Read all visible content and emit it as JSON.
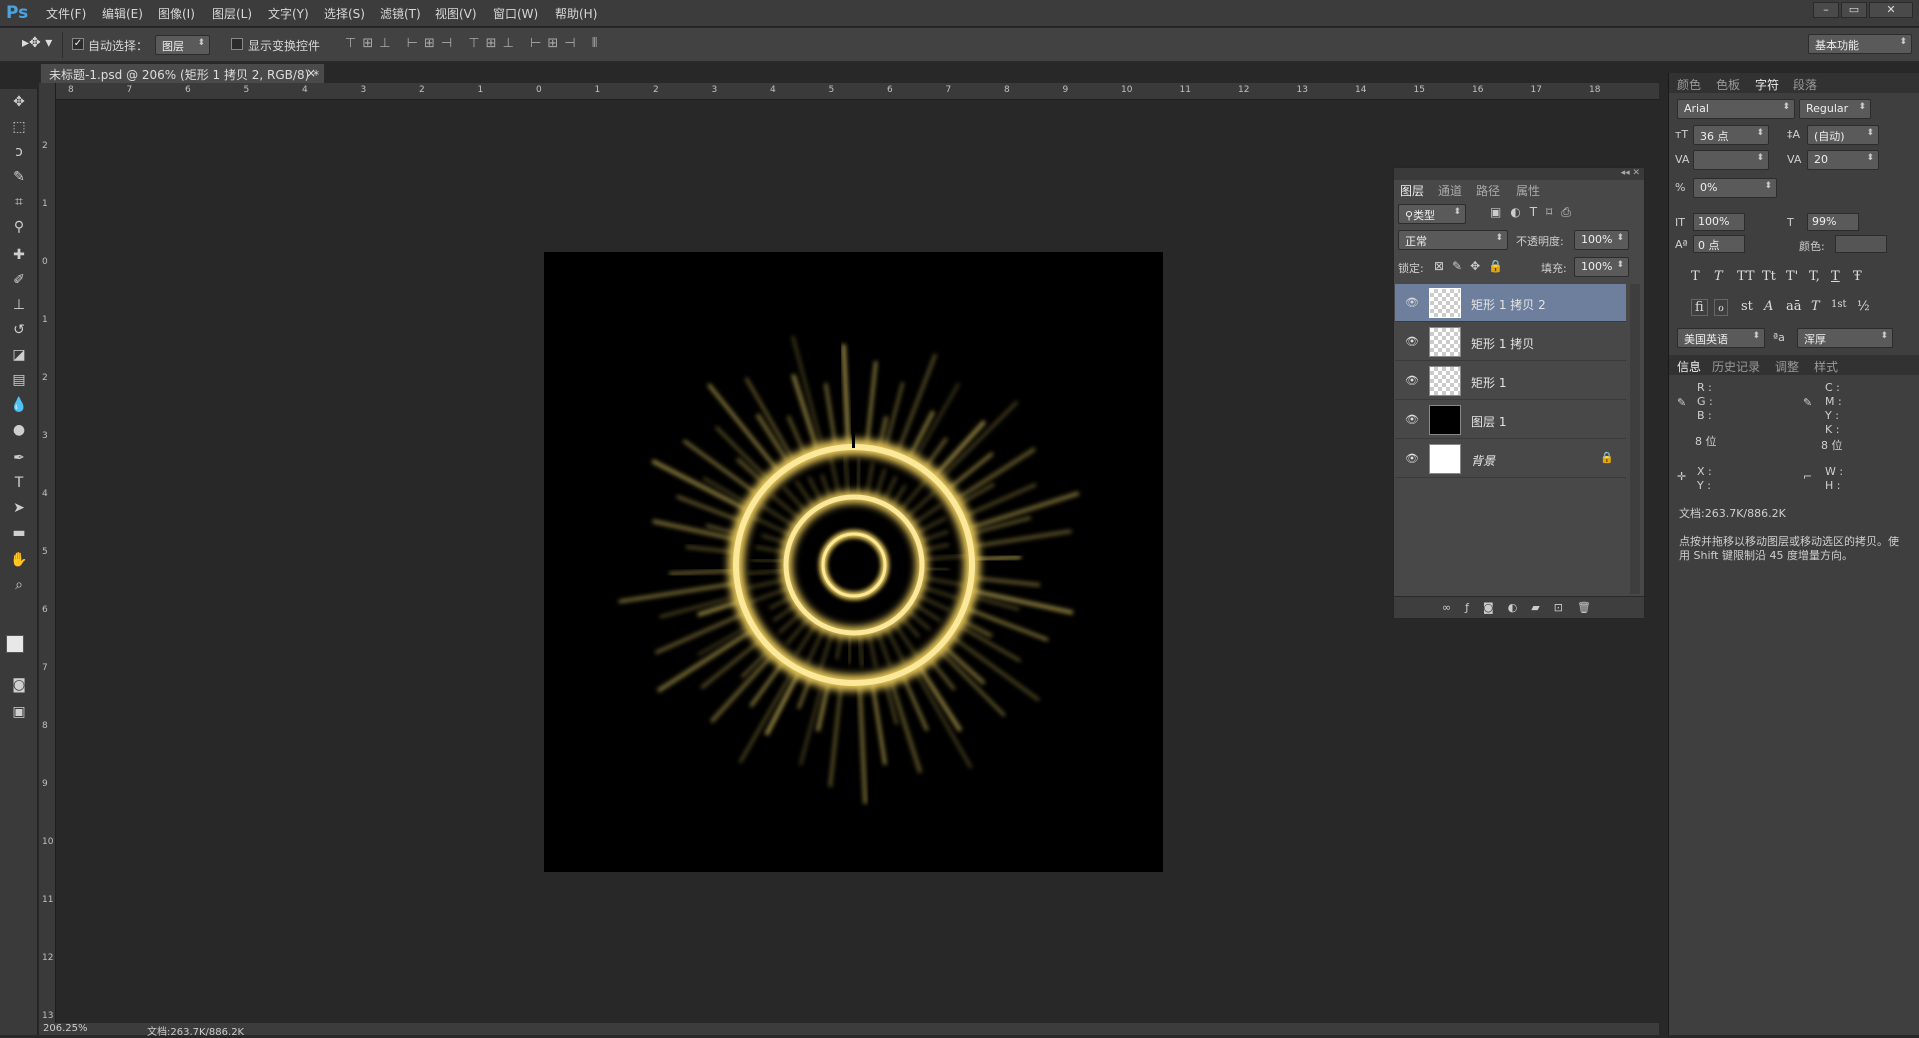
{
  "app": {
    "logo": "Ps"
  },
  "menu": [
    "文件(F)",
    "编辑(E)",
    "图像(I)",
    "图层(L)",
    "文字(Y)",
    "选择(S)",
    "滤镜(T)",
    "视图(V)",
    "窗口(W)",
    "帮助(H)"
  ],
  "window_buttons": [
    "–",
    "▭",
    "✕"
  ],
  "options": {
    "auto_select_label": "自动选择：",
    "auto_select_value": "图层",
    "show_transform_label": "显示变换控件",
    "workspace": "基本功能"
  },
  "document": {
    "tab_title": "未标题-1.psd @ 206% (矩形 1 拷贝 2, RGB/8) *",
    "tab_close": "×"
  },
  "ruler_h": [
    "8",
    "7",
    "6",
    "5",
    "4",
    "3",
    "2",
    "1",
    "0",
    "1",
    "2",
    "3",
    "4",
    "5",
    "6",
    "7",
    "8",
    "9",
    "10",
    "11",
    "12",
    "13",
    "14",
    "15",
    "16",
    "17",
    "18"
  ],
  "ruler_v": [
    "2",
    "1",
    "0",
    "1",
    "2",
    "3",
    "4",
    "5",
    "6",
    "7",
    "8",
    "9",
    "10",
    "11",
    "12",
    "13"
  ],
  "status": {
    "zoom": "206.25%",
    "doc": "文档:263.7K/886.2K"
  },
  "layers_panel": {
    "tabs": [
      "图层",
      "通道",
      "路径",
      "属性"
    ],
    "filter": "类型",
    "blend_mode": "正常",
    "opacity_label": "不透明度:",
    "opacity": "100%",
    "lock_label": "锁定:",
    "fill_label": "填充:",
    "fill": "100%",
    "layers": [
      {
        "name": "矩形 1 拷贝 2",
        "thumb": "transparent",
        "selected": true,
        "locked": false
      },
      {
        "name": "矩形 1 拷贝",
        "thumb": "transparent",
        "selected": false,
        "locked": false
      },
      {
        "name": "矩形 1",
        "thumb": "transparent",
        "selected": false,
        "locked": false
      },
      {
        "name": "图层 1",
        "thumb": "black",
        "selected": false,
        "locked": false
      },
      {
        "name": "背景",
        "thumb": "white",
        "selected": false,
        "locked": true
      }
    ],
    "footer_icons": [
      "link-icon",
      "fx-icon",
      "mask-icon",
      "adjustment-icon",
      "folder-icon",
      "new-layer-icon",
      "trash-icon"
    ]
  },
  "character_panel": {
    "tabs": [
      "颜色",
      "色板",
      "字符",
      "段落"
    ],
    "font_family": "Arial",
    "font_style": "Regular",
    "size": "36 点",
    "leading": "(自动)",
    "kerning": "",
    "tracking": "20",
    "scale_percent": "0%",
    "vscale": "100%",
    "hscale": "99%",
    "baseline": "0 点",
    "color_label": "颜色:",
    "style_buttons": [
      "T",
      "T",
      "TT",
      "Tt",
      "T'",
      "T,",
      "T",
      "Ŧ"
    ],
    "ot_buttons": [
      "fi",
      "ℴ",
      "st",
      "A",
      "aā",
      "T",
      "1st",
      "½"
    ],
    "language": "美国英语",
    "aa_label": "ªa",
    "antialias": "浑厚"
  },
  "info_panel": {
    "tabs": [
      "信息",
      "历史记录",
      "调整",
      "样式"
    ],
    "rgb": [
      "R :",
      "G :",
      "B :"
    ],
    "cmyk": [
      "C :",
      "M :",
      "Y :",
      "K :"
    ],
    "bits_left": "8 位",
    "bits_right": "8 位",
    "xy": [
      "X :",
      "Y :"
    ],
    "wh": [
      "W :",
      "H :"
    ],
    "doc": "文档:263.7K/886.2K",
    "hint": "点按并拖移以移动图层或移动选区的拷贝。使用 Shift 键限制沿 45 度增量方向。"
  },
  "colors": {
    "accent": "#4aa3df",
    "selected_layer": "#6d7f9c",
    "glow": "#f2d86a"
  }
}
